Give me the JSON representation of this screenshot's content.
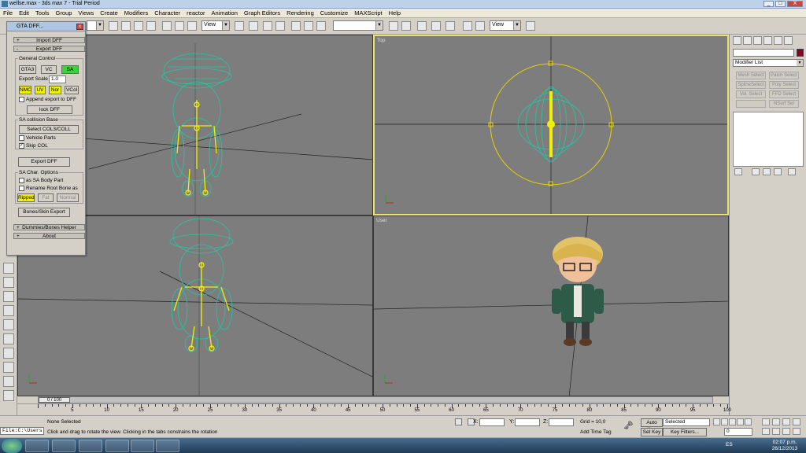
{
  "window": {
    "title": "wellse.max - 3ds max 7 - Trial Period",
    "controls": [
      "_",
      "□",
      "X"
    ]
  },
  "menu": [
    "File",
    "Edit",
    "Tools",
    "Group",
    "Views",
    "Create",
    "Modifiers",
    "Character",
    "reactor",
    "Animation",
    "Graph Editors",
    "Rendering",
    "Customize",
    "MAXScript",
    "Help"
  ],
  "toolbar": {
    "dropdown_view1": "View",
    "dropdown_view2": "View",
    "dropdown_selset": ""
  },
  "viewports": {
    "top_left": "",
    "top": "Top",
    "bottom_left": "",
    "user": "User"
  },
  "gta_panel": {
    "title": "GTA DFF...",
    "import_rollout": "Import DFF",
    "export_rollout": "Export DFF",
    "general_control": "General Control",
    "game_buttons": [
      "GTA3",
      "VC",
      "SA"
    ],
    "export_scale_label": "Export Scale",
    "export_scale_value": "1.0",
    "flag_buttons": [
      "NMC",
      "UV",
      "Nor",
      "VCol"
    ],
    "append_export": "Append export to DFF",
    "lock_dff": "lock DFF",
    "collision_group": "SA collision Base",
    "select_col": "Select COL3/COLL",
    "vehicle_parts": "Vehicle Parts",
    "skip_col": "Skip COL",
    "export_dff": "Export DFF",
    "char_options": "SA Char. Options",
    "as_body_part": "as SA Body Part",
    "rename_root": "Rename Root Bone as",
    "body_buttons": [
      "Ripped",
      "Fat",
      "Normal"
    ],
    "bones_export": "Bones/Skin Export",
    "dummies_rollout": "Dummies/Bones Helper",
    "about_rollout": "About"
  },
  "command_panel": {
    "modifier_list": "Modifier List",
    "buttons": [
      "Mesh Select",
      "Patch Select",
      "SplineSelect",
      "Poly Select",
      "Vol. Select",
      "FFD Select",
      "",
      "NSurf Sel"
    ]
  },
  "timeline": {
    "frame_label": "0 / 100",
    "ticks": [
      "5",
      "10",
      "15",
      "20",
      "25",
      "30",
      "35",
      "40",
      "45",
      "50",
      "55",
      "60",
      "65",
      "70",
      "75",
      "80",
      "85",
      "90",
      "95",
      "100"
    ]
  },
  "status": {
    "selection": "None Selected",
    "prompt": "Click and drag to rotate the view.  Clicking in the tabs constrains the rotation",
    "x_label": "X:",
    "y_label": "Y:",
    "z_label": "Z:",
    "grid": "Grid = 10,0",
    "add_time_tag": "Add Time Tag",
    "auto_key": "Auto Key",
    "set_key": "Set Key",
    "selected_dropdown": "Selected",
    "key_filters": "Key Filters...",
    "frame_value": "0",
    "listener": "File:C:\\Users"
  },
  "tray": {
    "lang": "ES",
    "time": "02:07 p.m.",
    "date": "26/12/2013"
  },
  "colors": {
    "wire": "#1fc9a4",
    "bones": "#f0f000",
    "viewport_bg": "#7d7d7d",
    "active_border": "#e8e36a"
  }
}
